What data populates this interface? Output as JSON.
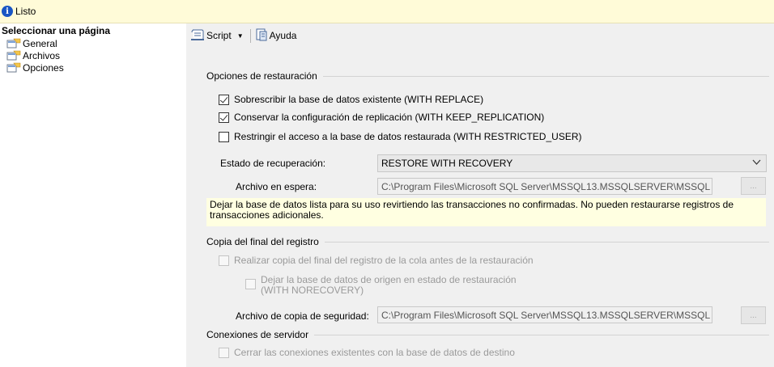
{
  "status": {
    "text": "Listo",
    "icon": "info-icon"
  },
  "sidebar": {
    "title": "Seleccionar una página",
    "items": [
      {
        "label": "General",
        "icon": "page-icon"
      },
      {
        "label": "Archivos",
        "icon": "page-icon"
      },
      {
        "label": "Opciones",
        "icon": "page-icon"
      }
    ]
  },
  "toolbar": {
    "script_label": "Script",
    "help_label": "Ayuda"
  },
  "restore_options": {
    "header": "Opciones de restauración",
    "with_replace": {
      "label": "Sobrescribir la base de datos existente (WITH REPLACE)",
      "checked": true
    },
    "keep_replication": {
      "label": "Conservar la configuración de replicación (WITH KEEP_REPLICATION)",
      "checked": true
    },
    "restricted_user": {
      "label": "Restringir el acceso a la base de datos restaurada (WITH RESTRICTED_USER)",
      "checked": false
    },
    "recovery_state_label": "Estado de recuperación:",
    "recovery_state_value": "RESTORE WITH RECOVERY",
    "standby_file_label": "Archivo en espera:",
    "standby_file_value": "C:\\Program Files\\Microsoft SQL Server\\MSSQL13.MSSQLSERVER\\MSSQL",
    "browse_label": "...",
    "description": "Dejar la base de datos lista para su uso revirtiendo las transacciones no confirmadas. No pueden restaurarse registros de transacciones adicionales."
  },
  "tail_log": {
    "header": "Copia del final del registro",
    "backup_tail": {
      "label": "Realizar copia del final del registro de la cola antes de la restauración",
      "checked": false
    },
    "norecovery_line1": "Dejar la base de datos de origen en estado de restauración",
    "norecovery_line2": "(WITH NORECOVERY)",
    "backup_file_label": "Archivo de copia de seguridad:",
    "backup_file_value": "C:\\Program Files\\Microsoft SQL Server\\MSSQL13.MSSQLSERVER\\MSSQL",
    "browse_label": "..."
  },
  "server_connections": {
    "header": "Conexiones de servidor",
    "close_connections": {
      "label": "Cerrar las conexiones existentes con la base de datos de destino",
      "checked": false
    }
  }
}
